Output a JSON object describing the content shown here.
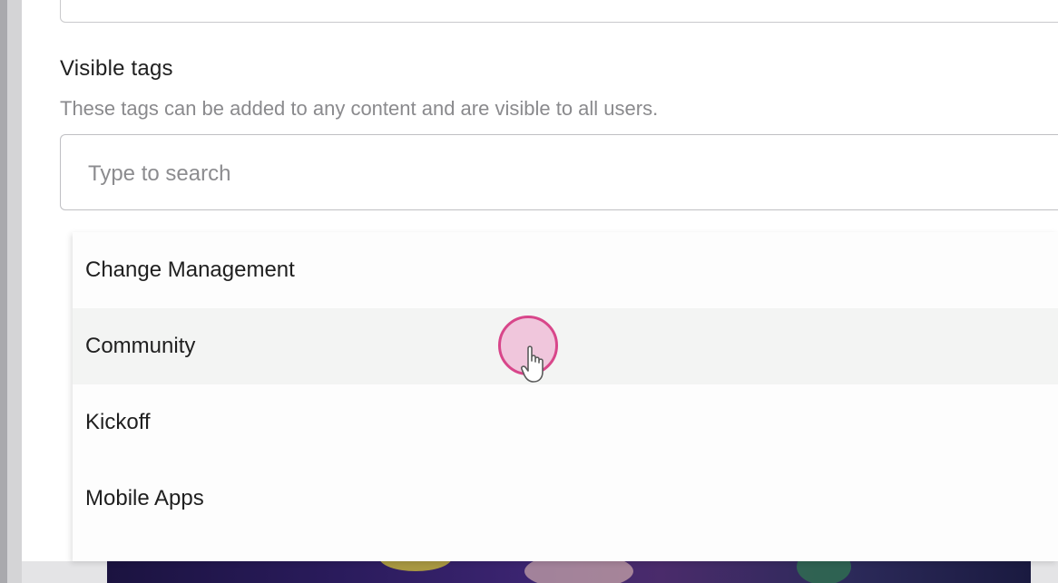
{
  "section": {
    "title": "Visible tags",
    "description": "These tags can be added to any content and are visible to all users."
  },
  "search": {
    "placeholder": "Type to search",
    "value": ""
  },
  "dropdown": {
    "options": [
      {
        "label": "Change Management",
        "hovered": false
      },
      {
        "label": "Community",
        "hovered": true
      },
      {
        "label": "Kickoff",
        "hovered": false
      },
      {
        "label": "Mobile Apps",
        "hovered": false
      }
    ]
  },
  "colors": {
    "cursor_highlight": "#d8468a",
    "hover_background": "#f3f4f3",
    "placeholder_text": "#8c8c8f"
  },
  "icons": {
    "cursor": "pointer-hand-icon"
  }
}
